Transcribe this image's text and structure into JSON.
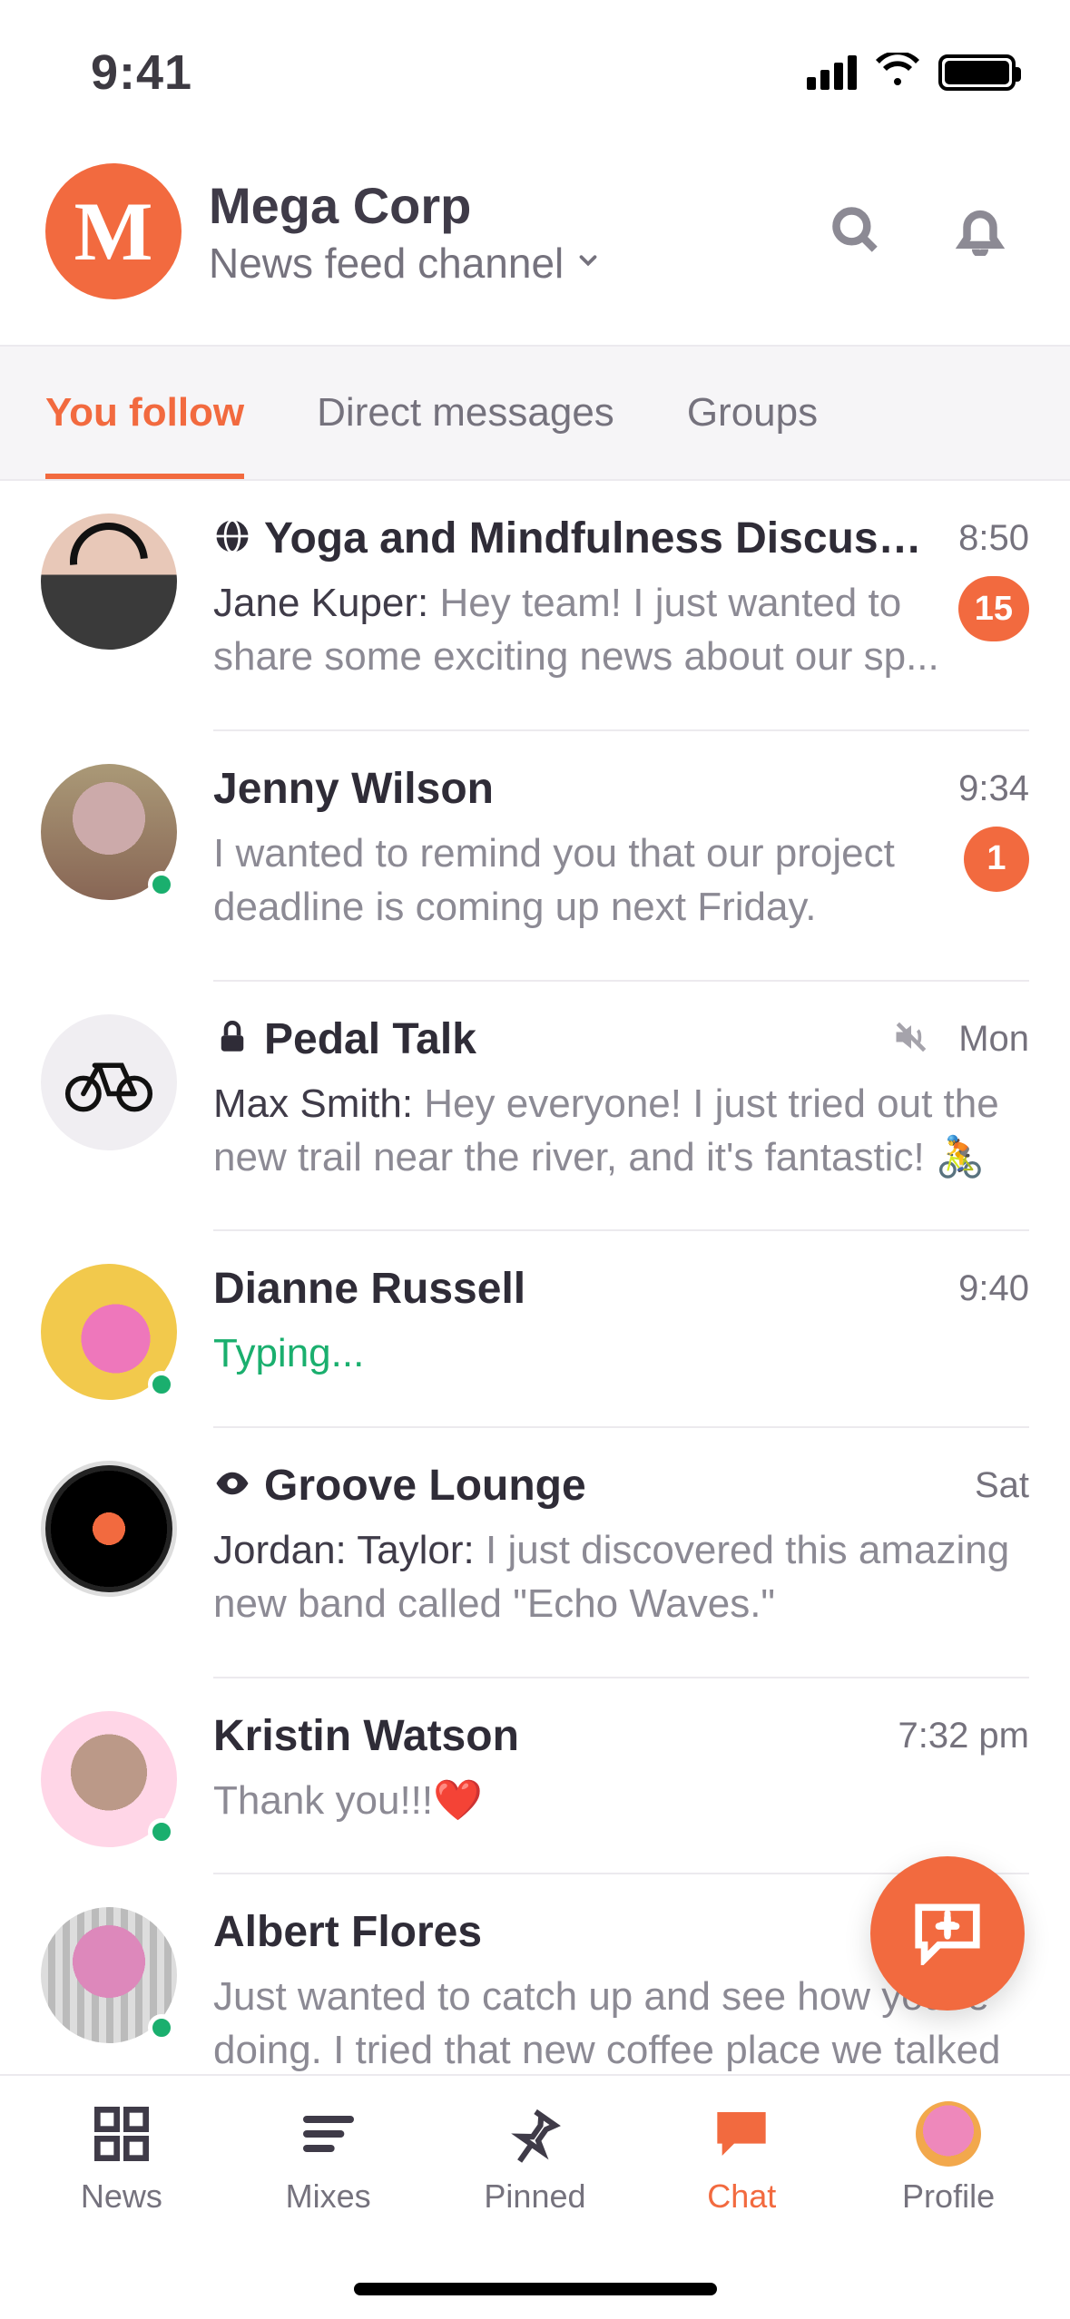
{
  "status": {
    "time": "9:41"
  },
  "header": {
    "org_letter": "M",
    "title": "Mega Corp",
    "subtitle": "News feed channel"
  },
  "tabs": [
    {
      "label": "You follow",
      "active": true
    },
    {
      "label": "Direct messages",
      "active": false
    },
    {
      "label": "Groups",
      "active": false
    }
  ],
  "chats": [
    {
      "id": "yoga",
      "title": "Yoga and Mindfulness Discussi...",
      "icon": "globe",
      "time": "8:50",
      "sender": "Jane Kuper:",
      "message": "Hey team! I just wanted to share some exciting news about our sp...",
      "badge": "15"
    },
    {
      "id": "jenny",
      "title": "Jenny Wilson",
      "time": "9:34",
      "message": "I wanted to remind you that our project deadline is coming up next Friday.",
      "badge": "1",
      "presence": true
    },
    {
      "id": "pedal",
      "title": "Pedal Talk",
      "icon": "lock",
      "muted": true,
      "time": "Mon",
      "sender": "Max Smith:",
      "message": "Hey everyone! I just tried out the new trail near the river, and it's fantastic! 🚴"
    },
    {
      "id": "dianne",
      "title": "Dianne Russell",
      "time": "9:40",
      "typing": "Typing...",
      "presence": true
    },
    {
      "id": "groove",
      "title": "Groove Lounge",
      "icon": "eye",
      "time": "Sat",
      "sender": "Jordan: Taylor:",
      "message": "I just discovered this amazing  new band called \"Echo Waves.\""
    },
    {
      "id": "kristin",
      "title": "Kristin Watson",
      "time": "7:32 pm",
      "message": "Thank you!!!❤️",
      "presence": true
    },
    {
      "id": "albert",
      "title": "Albert Flores",
      "time": "",
      "message": "Just wanted to catch up and see how you're doing. I tried that new coffee place we talked",
      "presence": true
    }
  ],
  "nav": {
    "items": [
      {
        "label": "News"
      },
      {
        "label": "Mixes"
      },
      {
        "label": "Pinned"
      },
      {
        "label": "Chat"
      },
      {
        "label": "Profile"
      }
    ],
    "active": "Chat"
  }
}
